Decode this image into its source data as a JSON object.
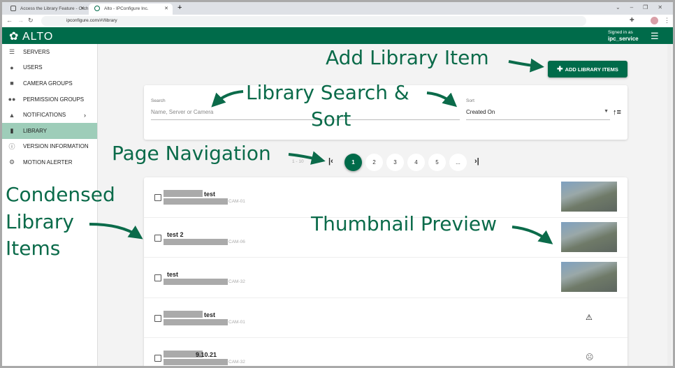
{
  "browser": {
    "tabs": [
      {
        "title": "Access the Library Feature - Orch"
      },
      {
        "title": "Alto - IPConfigure Inc."
      }
    ],
    "url": "ipconfigure.com/#!/library"
  },
  "header": {
    "logo": "ALTO",
    "signed_in_label": "Signed in as",
    "user": "ipc_service"
  },
  "sidebar": {
    "items": [
      {
        "label": "SERVERS",
        "icon": "servers-icon"
      },
      {
        "label": "USERS",
        "icon": "user-icon"
      },
      {
        "label": "CAMERA GROUPS",
        "icon": "camera-icon"
      },
      {
        "label": "PERMISSION GROUPS",
        "icon": "group-icon"
      },
      {
        "label": "NOTIFICATIONS",
        "icon": "bell-icon"
      },
      {
        "label": "LIBRARY",
        "icon": "bookmark-icon"
      },
      {
        "label": "VERSION INFORMATION",
        "icon": "info-icon"
      },
      {
        "label": "MOTION ALERTER",
        "icon": "motion-icon"
      }
    ]
  },
  "toolbar": {
    "add_label": "ADD LIBRARY ITEMS"
  },
  "search": {
    "label": "Search",
    "placeholder": "Name, Server or Camera",
    "sort_label": "Sort",
    "sort_value": "Created On"
  },
  "pagination": {
    "range": "1 - 10",
    "pages": [
      "1",
      "2",
      "3",
      "4",
      "5",
      "..."
    ],
    "current": "1"
  },
  "items": [
    {
      "name": "test",
      "camera": "CAM-01",
      "preview": "thumbnail"
    },
    {
      "name": "test 2",
      "camera": "CAM-06",
      "preview": "thumbnail"
    },
    {
      "name": "test",
      "camera": "CAM-32",
      "preview": "thumbnail"
    },
    {
      "name": "test",
      "camera": "CAM-01",
      "preview": "warning-icon"
    },
    {
      "name": "9.10.21",
      "camera": "CAM-32",
      "preview": "sad-face-icon"
    }
  ],
  "annotations": {
    "add": "Add Library Item",
    "search1": "Library Search &",
    "search2": "Sort",
    "page": "Page Navigation",
    "cond1": "Condensed",
    "cond2": "Library",
    "cond3": "Items",
    "thumb": "Thumbnail Preview"
  },
  "colors": {
    "brand": "#006b4a",
    "active": "#9ecdb9"
  }
}
